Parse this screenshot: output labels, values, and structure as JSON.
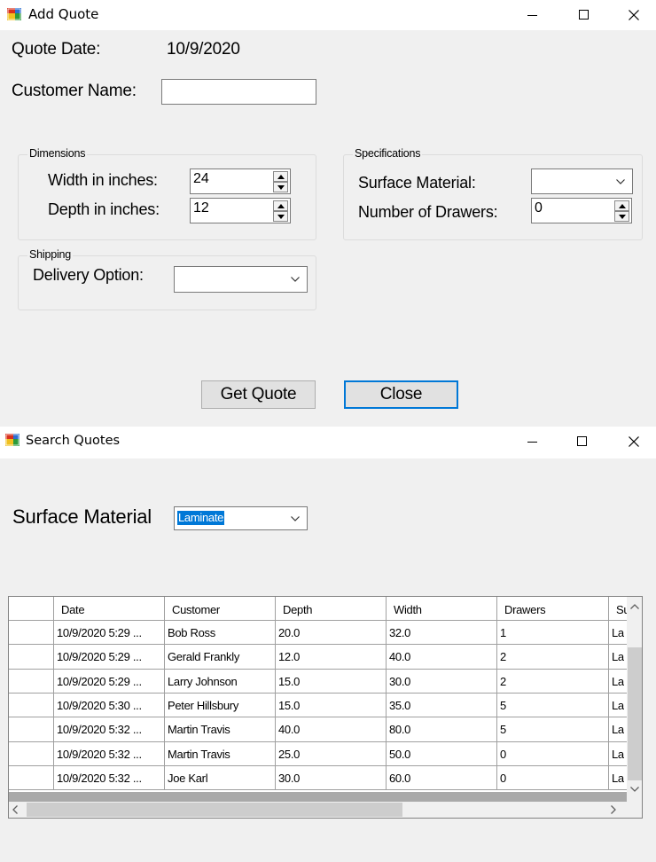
{
  "add_quote": {
    "title": "Add Quote",
    "quote_date_label": "Quote Date:",
    "quote_date_value": "10/9/2020",
    "customer_name_label": "Customer Name:",
    "customer_name_value": "",
    "dimensions": {
      "caption": "Dimensions",
      "width_label": "Width in inches:",
      "width_value": "24",
      "depth_label": "Depth in inches:",
      "depth_value": "12"
    },
    "specifications": {
      "caption": "Specifications",
      "surface_label": "Surface Material:",
      "surface_value": "",
      "drawers_label": "Number of Drawers:",
      "drawers_value": "0"
    },
    "shipping": {
      "caption": "Shipping",
      "delivery_label": "Delivery Option:",
      "delivery_value": ""
    },
    "get_quote_button": "Get Quote",
    "close_button": "Close"
  },
  "search_quotes": {
    "title": "Search Quotes",
    "surface_label": "Surface Material",
    "surface_value": "Laminate",
    "grid": {
      "columns": [
        "Date",
        "Customer",
        "Depth",
        "Width",
        "Drawers",
        "Su"
      ],
      "rows": [
        [
          "10/9/2020 5:29 ...",
          "Bob Ross",
          "20.0",
          "32.0",
          "1",
          "La"
        ],
        [
          "10/9/2020 5:29 ...",
          "Gerald Frankly",
          "12.0",
          "40.0",
          "2",
          "La"
        ],
        [
          "10/9/2020 5:29 ...",
          "Larry Johnson",
          "15.0",
          "30.0",
          "2",
          "La"
        ],
        [
          "10/9/2020 5:30 ...",
          "Peter Hillsbury",
          "15.0",
          "35.0",
          "5",
          "La"
        ],
        [
          "10/9/2020 5:32 ...",
          "Martin Travis",
          "40.0",
          "80.0",
          "5",
          "La"
        ],
        [
          "10/9/2020 5:32 ...",
          "Martin Travis",
          "25.0",
          "50.0",
          "0",
          "La"
        ],
        [
          "10/9/2020 5:32 ...",
          "Joe Karl",
          "30.0",
          "60.0",
          "0",
          "La"
        ]
      ]
    }
  },
  "icons": {
    "app": "app-window-icon",
    "minimize": "minimize-icon",
    "maximize": "maximize-icon",
    "close": "close-icon"
  },
  "colors": {
    "focus_blue": "#0078d7",
    "window_bg": "#f0f0f0"
  }
}
